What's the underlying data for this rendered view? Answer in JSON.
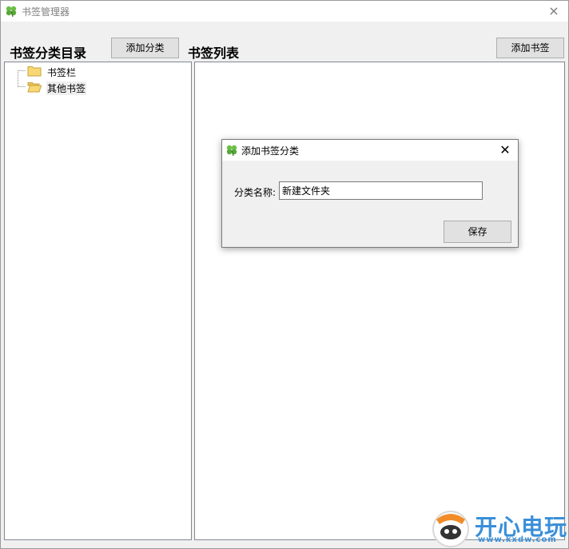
{
  "window": {
    "title": "书签管理器",
    "close_icon": "×"
  },
  "categories": {
    "heading": "书签分类目录",
    "add_button": "添加分类",
    "tree": [
      {
        "label": "书签栏",
        "icon": "folder-icon",
        "selected": false
      },
      {
        "label": "其他书签",
        "icon": "folder-open-icon",
        "selected": true
      }
    ]
  },
  "bookmarks": {
    "heading": "书签列表",
    "add_button": "添加书签"
  },
  "dialog": {
    "title": "添加书签分类",
    "close_icon": "✕",
    "field_label": "分类名称:",
    "field_value": "新建文件夹",
    "save_button": "保存"
  },
  "watermark": {
    "text": "开心电玩",
    "sub": "www.kxdw.com"
  },
  "colors": {
    "window_bg": "#f0f0f0",
    "panel_bg": "#ffffff",
    "clover": "#4caf50",
    "watermark": "#3a8fd8"
  }
}
